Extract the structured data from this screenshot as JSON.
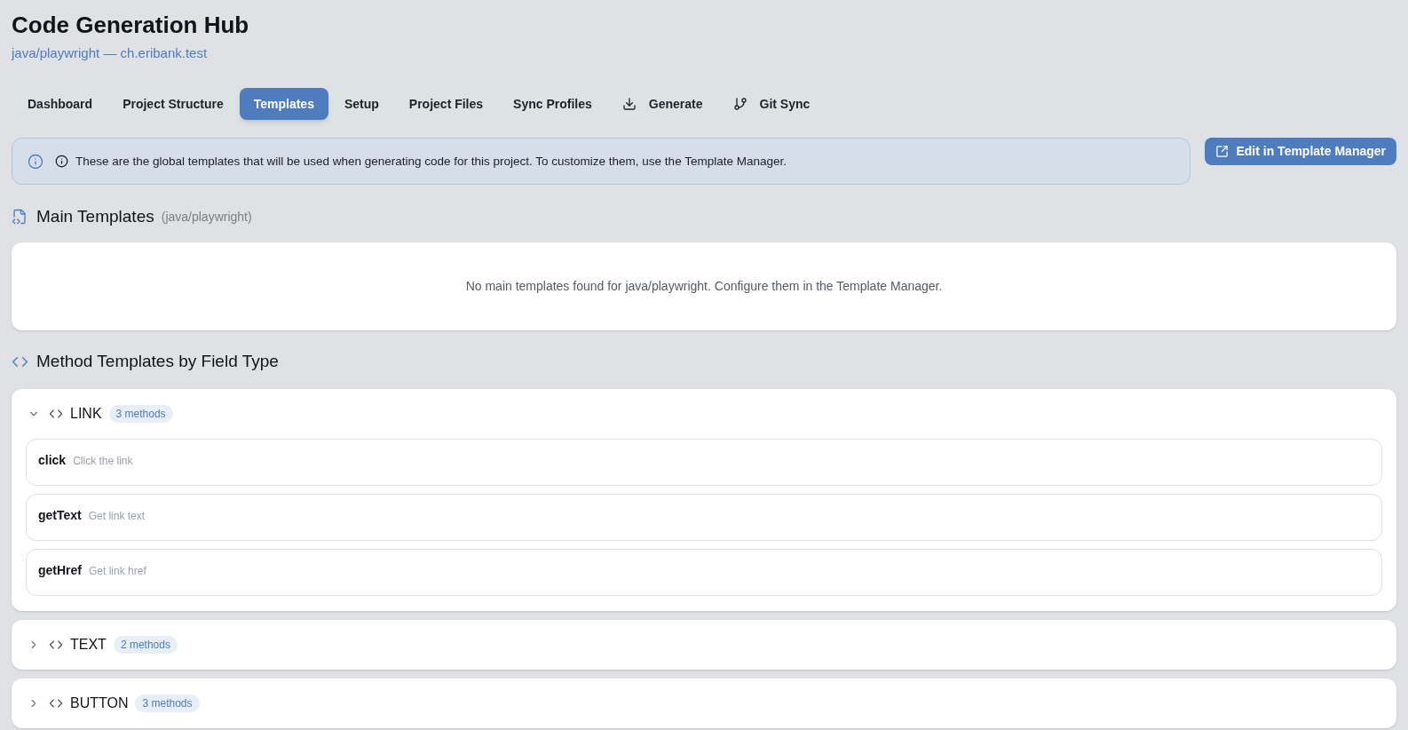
{
  "header": {
    "title": "Code Generation Hub",
    "subtitle": "java/playwright — ch.eribank.test"
  },
  "tabs": [
    {
      "label": "Dashboard",
      "kind": "page",
      "selected": false
    },
    {
      "label": "Project Structure",
      "kind": "page",
      "selected": false
    },
    {
      "label": "Templates",
      "kind": "page",
      "selected": true
    },
    {
      "label": "Setup",
      "kind": "page",
      "selected": false
    },
    {
      "label": "Project Files",
      "kind": "page",
      "selected": false
    },
    {
      "label": "Sync Profiles",
      "kind": "page",
      "selected": false
    },
    {
      "label": "Generate",
      "kind": "generate",
      "selected": false
    },
    {
      "label": "Git Sync",
      "kind": "git_sync",
      "selected": false
    }
  ],
  "notice": {
    "text": "These are the global templates that will be used when generating code for this project. To customize them, use the Template Manager.",
    "button": "Edit in Template Manager"
  },
  "main_templates": {
    "title": "Main Templates",
    "scope": "(java/playwright)",
    "empty_message": "No main templates found for java/playwright. Configure them in the Template Manager."
  },
  "method_templates": {
    "title": "Method Templates by Field Type",
    "groups": [
      {
        "name": "LINK",
        "count": "3 methods",
        "expanded": true,
        "methods": [
          {
            "name": "click",
            "description": "Click the link"
          },
          {
            "name": "getText",
            "description": "Get link text"
          },
          {
            "name": "getHref",
            "description": "Get link href"
          }
        ]
      },
      {
        "name": "TEXT",
        "count": "2 methods",
        "expanded": false
      },
      {
        "name": "BUTTON",
        "count": "3 methods",
        "expanded": false
      }
    ]
  }
}
